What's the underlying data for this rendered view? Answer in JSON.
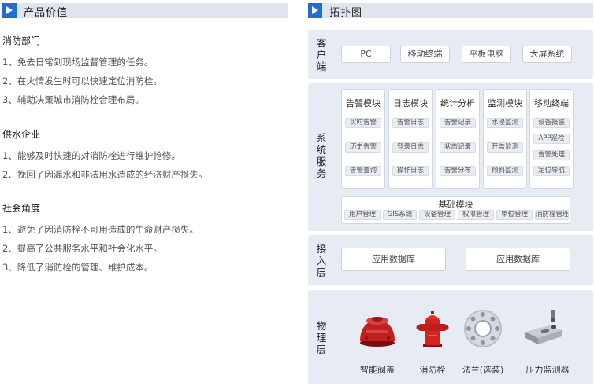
{
  "left": {
    "title": "产品价值",
    "groups": [
      {
        "title": "消防部门",
        "items": [
          "1、免去日常到现场监督管理的任务。",
          "2、在火情发生时可以快速定位消防栓。",
          "3、辅助决策城市消防栓合理布局。"
        ]
      },
      {
        "title": "供水企业",
        "items": [
          "1、能够及时快速的对消防栓进行维护抢修。",
          "2、挽回了因漏水和非法用水造成的经济财产损失。"
        ]
      },
      {
        "title": "社会角度",
        "items": [
          "1、避免了因消防栓不可用造成的生命财产损失。",
          "2、提高了公共服务水平和社会化水平。",
          "3、降低了消防栓的管理、维护成本。"
        ]
      }
    ]
  },
  "right": {
    "title": "拓扑图",
    "client_layer": {
      "label": "客户端",
      "items": [
        "PC",
        "移动终端",
        "平板电脑",
        "大屏系统"
      ]
    },
    "service_layer": {
      "label": "系统服务",
      "modules": [
        {
          "title": "告警模块",
          "tags": [
            "实时告警",
            "历史告警",
            "告警查询"
          ]
        },
        {
          "title": "日志模块",
          "tags": [
            "告警日志",
            "登录日志",
            "操作日志"
          ]
        },
        {
          "title": "统计分析",
          "tags": [
            "告警记录",
            "状态记录",
            "告警分布"
          ]
        },
        {
          "title": "监测模块",
          "tags": [
            "水浸监测",
            "开盖监测",
            "倾斜监测"
          ]
        },
        {
          "title": "移动终端",
          "tags": [
            "设备报装",
            "APP巡检",
            "告警处理",
            "定位导航"
          ]
        }
      ],
      "base": {
        "title": "基础模块",
        "tags": [
          "用户管理",
          "GIS系统",
          "设备管理",
          "权限管理",
          "单位管理",
          "消防栓管理"
        ]
      }
    },
    "access_layer": {
      "label": "接入层",
      "items": [
        "应用数据库",
        "应用数据库"
      ]
    },
    "physical_layer": {
      "label": "物理层",
      "devices": [
        "智能阀盖",
        "消防栓",
        "法兰(选装)",
        "压力监测器"
      ]
    }
  }
}
